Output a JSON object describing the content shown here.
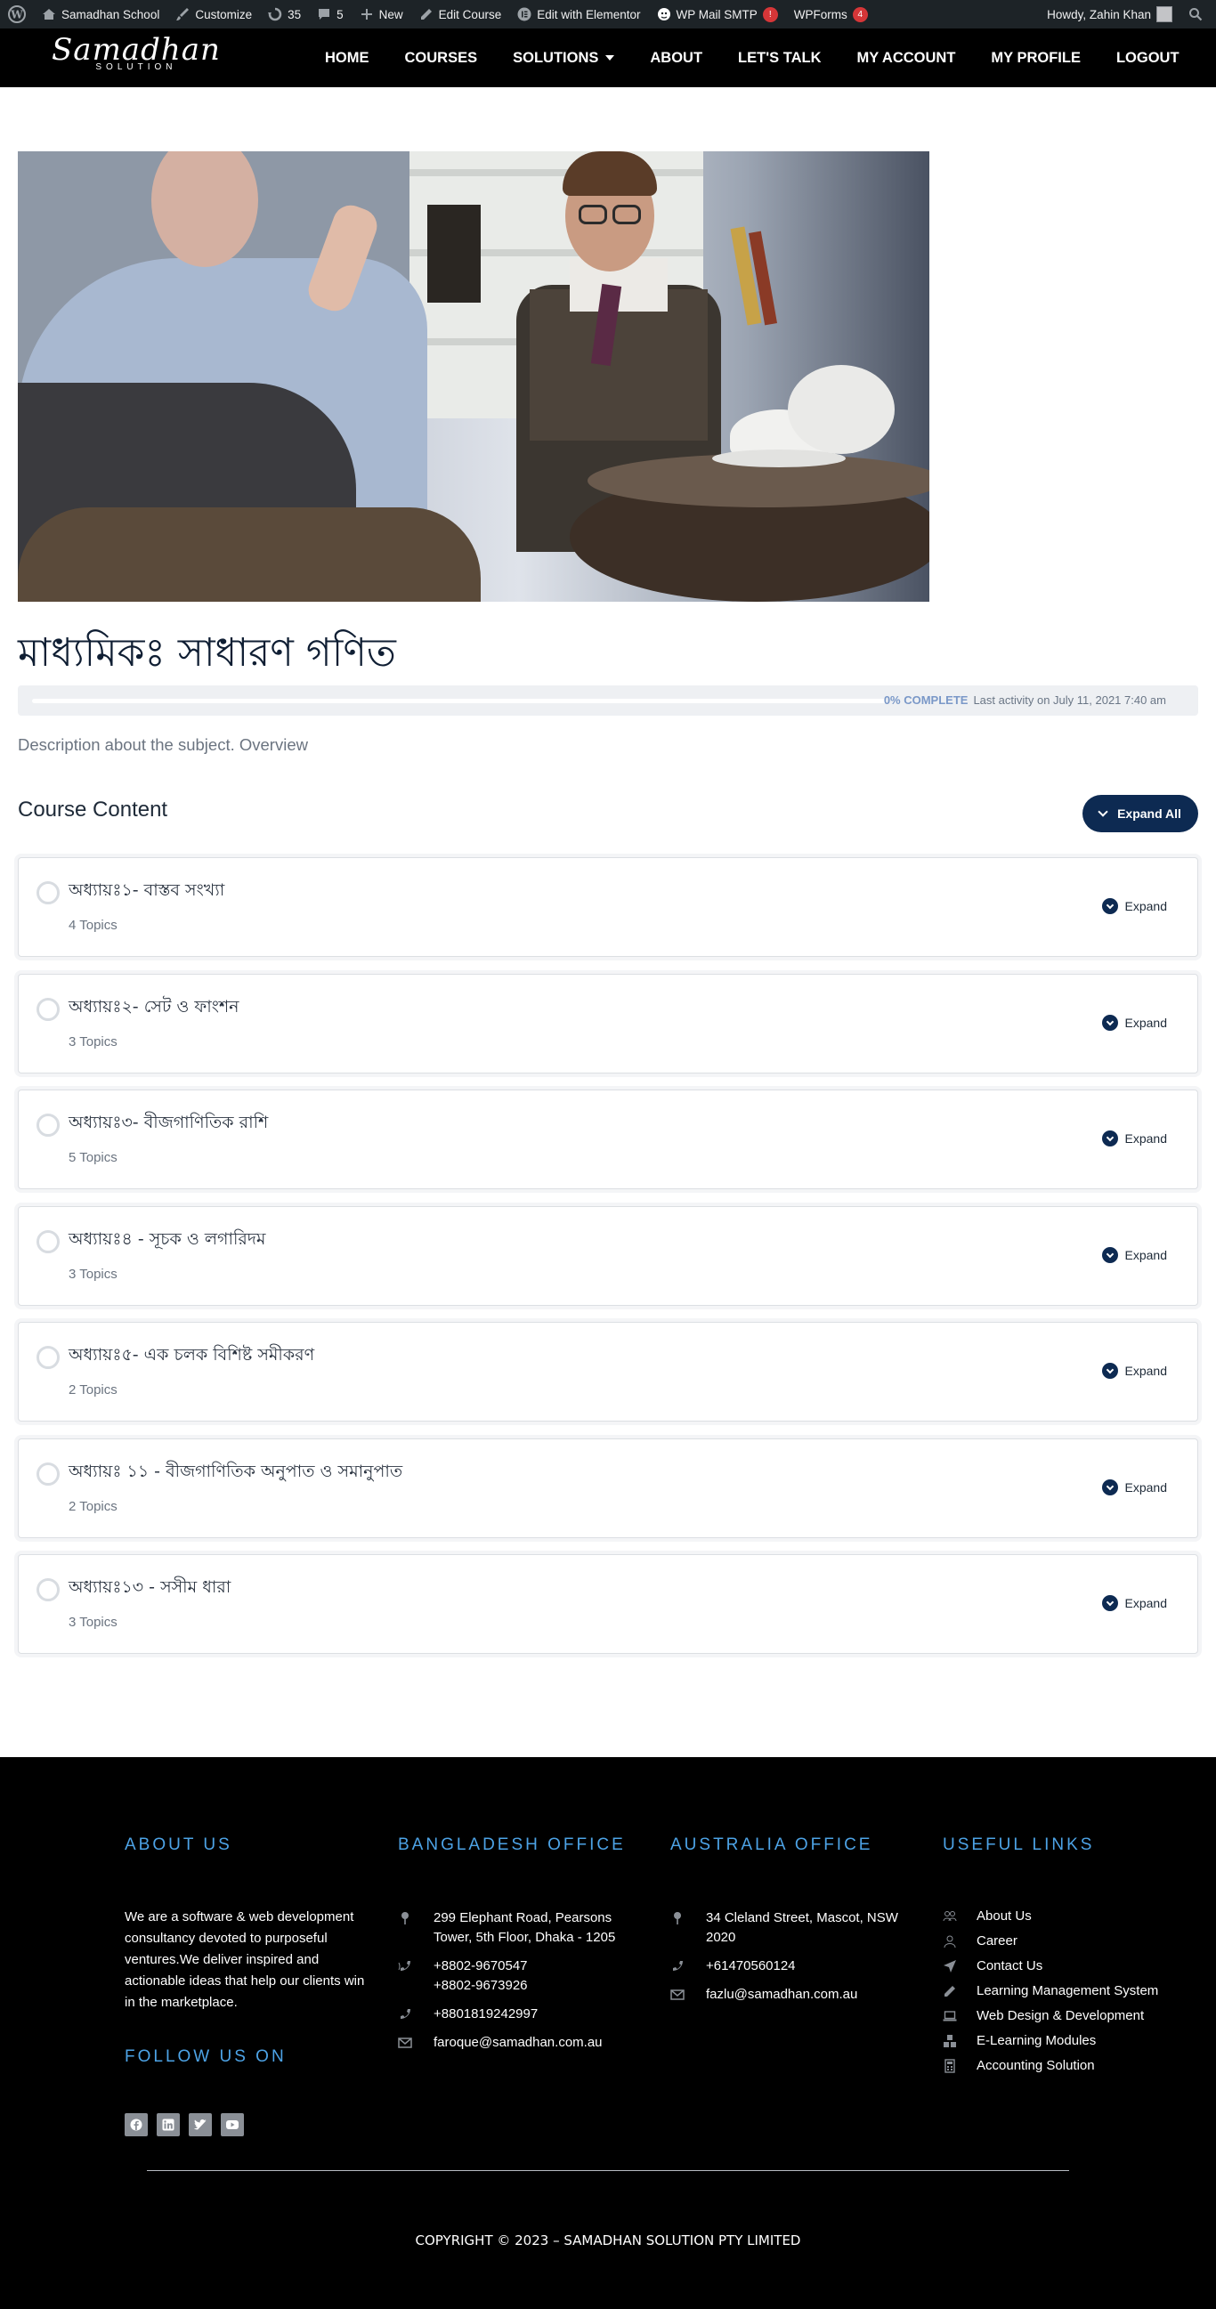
{
  "admin_bar": {
    "items": [
      {
        "label": "Samadhan School",
        "icon": "house-icon"
      },
      {
        "label": "Customize",
        "icon": "brush-icon"
      },
      {
        "label": "35",
        "icon": "refresh-icon"
      },
      {
        "label": "5",
        "icon": "comment-icon"
      },
      {
        "label": "New",
        "icon": "plus-icon"
      },
      {
        "label": "Edit Course",
        "icon": "pencil-icon"
      },
      {
        "label": "Edit with Elementor",
        "icon": "elementor-icon"
      },
      {
        "label": "WP Mail SMTP",
        "badge": "!"
      },
      {
        "label": "WPForms",
        "badge": "4"
      }
    ],
    "howdy": "Howdy, Zahin Khan"
  },
  "header": {
    "logo_script": "Samadhan",
    "logo_sub": "SOLUTION",
    "nav": [
      "HOME",
      "COURSES",
      "SOLUTIONS",
      "ABOUT",
      "LET'S TALK",
      "MY ACCOUNT",
      "MY PROFILE",
      "LOGOUT"
    ]
  },
  "course": {
    "title": "মাধ্যমিকঃ সাধারণ গণিত",
    "progress_percent": 0,
    "progress_label": "0% COMPLETE",
    "last_activity": "Last activity on July 11, 2021 7:40 am",
    "description": "Description about the subject. Overview",
    "content_heading": "Course Content",
    "expand_all": "Expand All",
    "expand_label": "Expand",
    "lessons": [
      {
        "title": "অধ্যায়ঃ১- বাস্তব সংখ্যা",
        "topics": "4 Topics"
      },
      {
        "title": "অধ্যায়ঃ২- সেট ও ফাংশন",
        "topics": "3 Topics"
      },
      {
        "title": "অধ্যায়ঃ৩- বীজগাণিতিক রাশি",
        "topics": "5 Topics"
      },
      {
        "title": "অধ্যায়ঃ৪ - সূচক ও লগারিদম",
        "topics": "3 Topics"
      },
      {
        "title": "অধ্যায়ঃ৫- এক চলক বিশিষ্ট সমীকরণ",
        "topics": "2 Topics"
      },
      {
        "title": "অধ্যায়ঃ ১১ - বীজগাণিতিক অনুপাত ও সমানুপাত",
        "topics": "2 Topics"
      },
      {
        "title": "অধ্যায়ঃ১৩ - সসীম ধারা",
        "topics": "3 Topics"
      }
    ]
  },
  "footer": {
    "about_heading": "ABOUT US",
    "about_text": "We are a software & web development consultancy devoted to purposeful ventures.We deliver inspired and actionable ideas that help our clients win in the marketplace.",
    "follow_heading": "FOLLOW US ON",
    "social": [
      "facebook-icon",
      "linkedin-icon",
      "twitter-icon",
      "youtube-icon"
    ],
    "bd_heading": "BANGLADESH OFFICE",
    "bd_address": "299 Elephant Road, Pearsons Tower, 5th Floor, Dhaka - 1205",
    "bd_phone1": "+8802-9670547\n+8802-9673926",
    "bd_phone2": "+8801819242997",
    "bd_email": "faroque@samadhan.com.au",
    "au_heading": "AUSTRALIA OFFICE",
    "au_address": "34 Cleland Street, Mascot, NSW 2020",
    "au_phone": "+61470560124",
    "au_email": "fazlu@samadhan.com.au",
    "links_heading": "USEFUL LINKS",
    "links": [
      {
        "label": "About Us",
        "icon": "users-icon"
      },
      {
        "label": "Career",
        "icon": "user-icon"
      },
      {
        "label": "Contact Us",
        "icon": "paper-plane-icon"
      },
      {
        "label": "Learning Management System",
        "icon": "pencil-icon"
      },
      {
        "label": "Web Design & Development",
        "icon": "laptop-icon"
      },
      {
        "label": "E-Learning Modules",
        "icon": "cubes-icon"
      },
      {
        "label": "Accounting Solution",
        "icon": "calculator-icon"
      }
    ],
    "copyright": "COPYRIGHT © 2023 – SAMADHAN SOLUTION PTY LIMITED"
  }
}
